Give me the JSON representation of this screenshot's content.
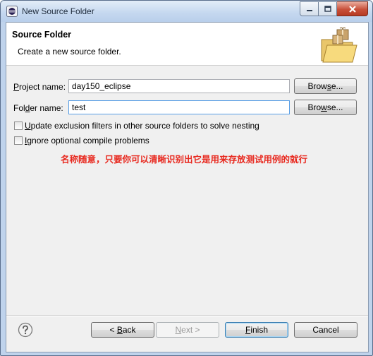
{
  "window": {
    "title": "New Source Folder",
    "icons": {
      "app": "eclipse-icon",
      "minimize": "minimize-icon",
      "maximize": "maximize-icon",
      "close": "close-icon"
    }
  },
  "header": {
    "title": "Source Folder",
    "description": "Create a new source folder.",
    "image": "folder-with-package-icon"
  },
  "form": {
    "project_label_pre": "P",
    "project_label_post": "roject name:",
    "project_value": "day150_eclipse",
    "folder_label_pre": "Fol",
    "folder_label_mn": "d",
    "folder_label_post": "er name:",
    "folder_value": "test",
    "browse_pre": "Brow",
    "browse_mn": "s",
    "browse_post": "e...",
    "browse2_pre": "Bro",
    "browse2_mn": "w",
    "browse2_post": "se..."
  },
  "options": [
    {
      "mn": "U",
      "rest": "pdate exclusion filters in other source folders to solve nesting",
      "checked": false
    },
    {
      "mn": "I",
      "rest": "gnore optional compile problems",
      "checked": false
    }
  ],
  "annotation": "名称随意，只要你可以清晰识别出它是用来存放测试用例的就行",
  "colors": {
    "annotation": "#e8281e",
    "focus_border": "#569de5"
  },
  "footer": {
    "back_pre": "< ",
    "back_mn": "B",
    "back_post": "ack",
    "next_pre": "",
    "next_mn": "N",
    "next_post": "ext >",
    "finish_pre": "",
    "finish_mn": "F",
    "finish_post": "inish",
    "cancel": "Cancel",
    "help_icon": "help-question-icon"
  }
}
